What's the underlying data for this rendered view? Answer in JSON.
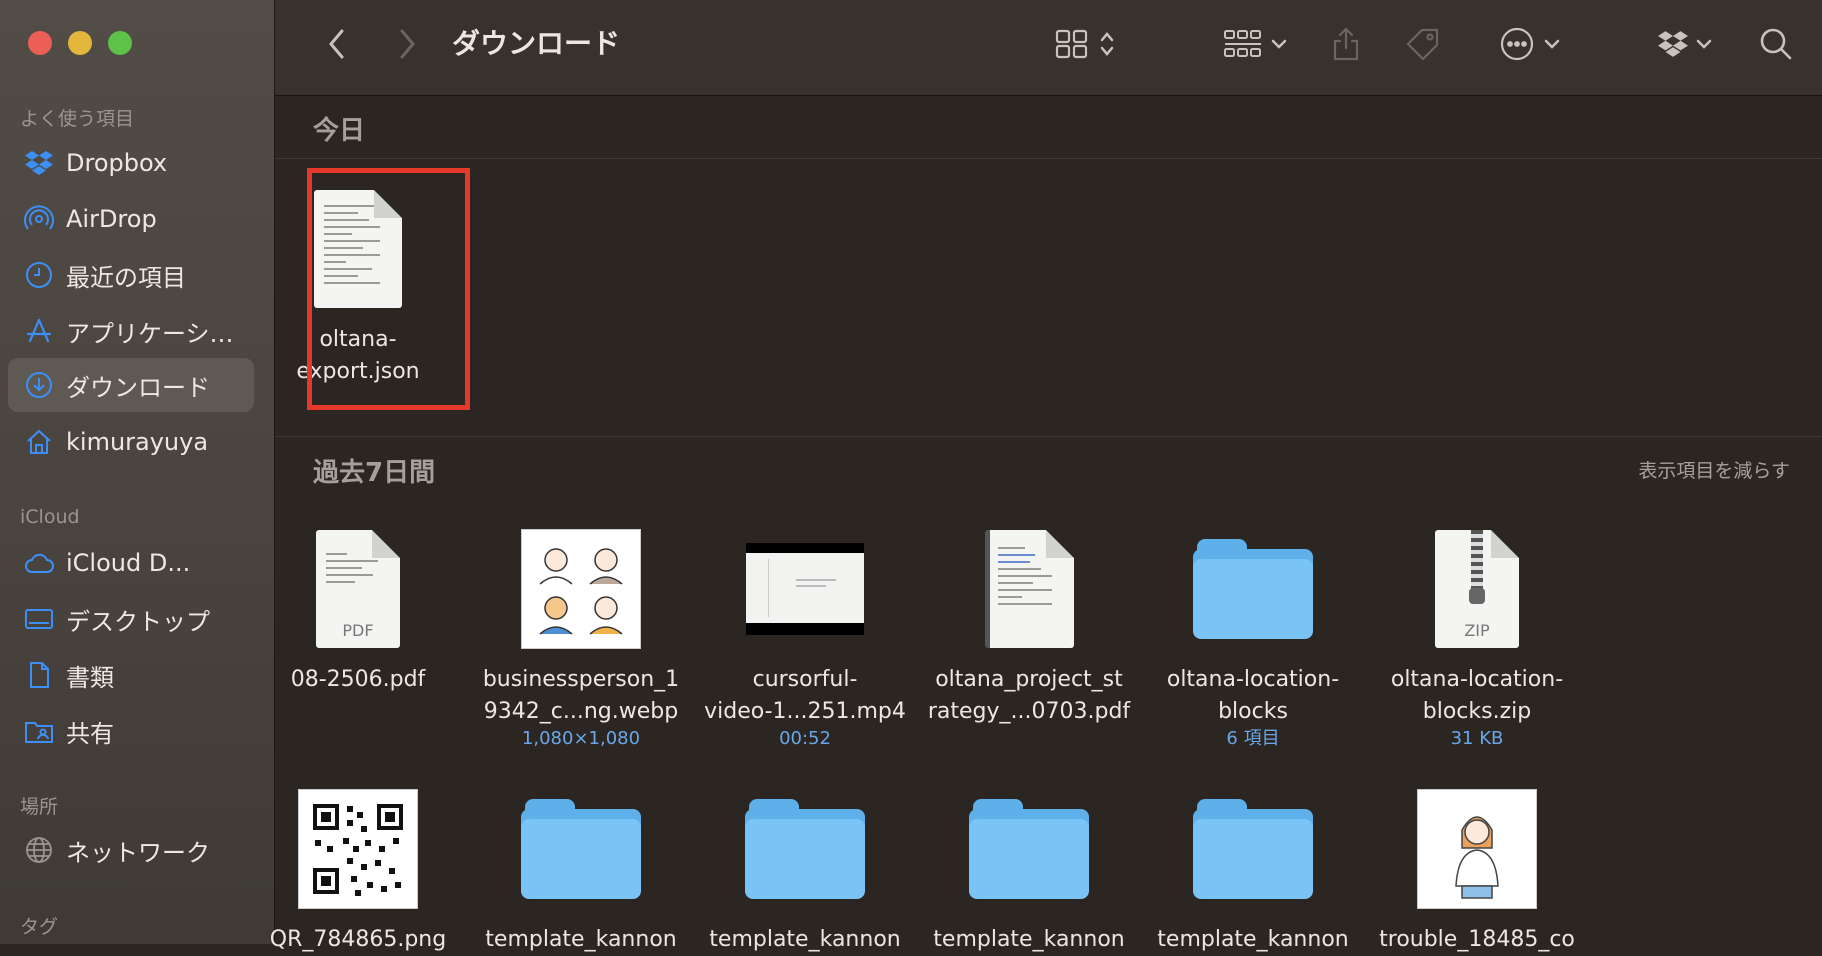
{
  "window": {
    "title": "ダウンロード"
  },
  "sidebar": {
    "favorites_heading": "よく使う項目",
    "favorites": [
      {
        "label": "Dropbox",
        "icon": "dropbox-icon"
      },
      {
        "label": "AirDrop",
        "icon": "airdrop-icon"
      },
      {
        "label": "最近の項目",
        "icon": "clock-icon"
      },
      {
        "label": "アプリケーシ…",
        "icon": "applications-icon"
      },
      {
        "label": "ダウンロード",
        "icon": "download-icon",
        "selected": true
      },
      {
        "label": "kimurayuya",
        "icon": "home-icon"
      }
    ],
    "icloud_heading": "iCloud",
    "icloud": [
      {
        "label": "iCloud D...",
        "icon": "cloud-icon"
      },
      {
        "label": "デスクトップ",
        "icon": "desktop-icon"
      },
      {
        "label": "書類",
        "icon": "document-icon"
      },
      {
        "label": "共有",
        "icon": "shared-folder-icon"
      }
    ],
    "locations_heading": "場所",
    "locations": [
      {
        "label": "ネットワーク",
        "icon": "network-icon"
      }
    ],
    "tags_heading": "タグ"
  },
  "sections": {
    "today": {
      "title": "今日",
      "items": [
        {
          "name_line1": "oltana-",
          "name_line2": "export.json",
          "kind": "json",
          "selected": true
        }
      ]
    },
    "past7": {
      "title": "過去7日間",
      "show_less": "表示項目を減らす",
      "items": [
        {
          "name_line1": "08-2506.pdf",
          "name_line2": "",
          "meta": "",
          "kind": "pdf",
          "doc_label": "PDF"
        },
        {
          "name_line1": "businessperson_1",
          "name_line2": "9342_c...ng.webp",
          "meta": "1,080×1,080",
          "kind": "image"
        },
        {
          "name_line1": "cursorful-",
          "name_line2": "video-1...251.mp4",
          "meta": "00:52",
          "kind": "video"
        },
        {
          "name_line1": "oltana_project_st",
          "name_line2": "rategy_...0703.pdf",
          "meta": "",
          "kind": "pdf2"
        },
        {
          "name_line1": "oltana-location-",
          "name_line2": "blocks",
          "meta": "6 項目",
          "kind": "folder"
        },
        {
          "name_line1": "oltana-location-",
          "name_line2": "blocks.zip",
          "meta": "31 KB",
          "kind": "zip",
          "doc_label": "ZIP"
        }
      ],
      "row2": [
        {
          "name_line1": "QR_784865.png",
          "kind": "qr"
        },
        {
          "name_line1": "template_kannon",
          "kind": "folder"
        },
        {
          "name_line1": "template_kannon",
          "kind": "folder"
        },
        {
          "name_line1": "template_kannon",
          "kind": "folder"
        },
        {
          "name_line1": "template_kannon",
          "kind": "folder"
        },
        {
          "name_line1": "trouble_18485_co",
          "kind": "image2"
        }
      ]
    }
  },
  "colors": {
    "accent": "#3d8ff5",
    "selection_box": "#e5392b",
    "folder": "#79c3f5",
    "meta_text": "#6aa7ea"
  }
}
